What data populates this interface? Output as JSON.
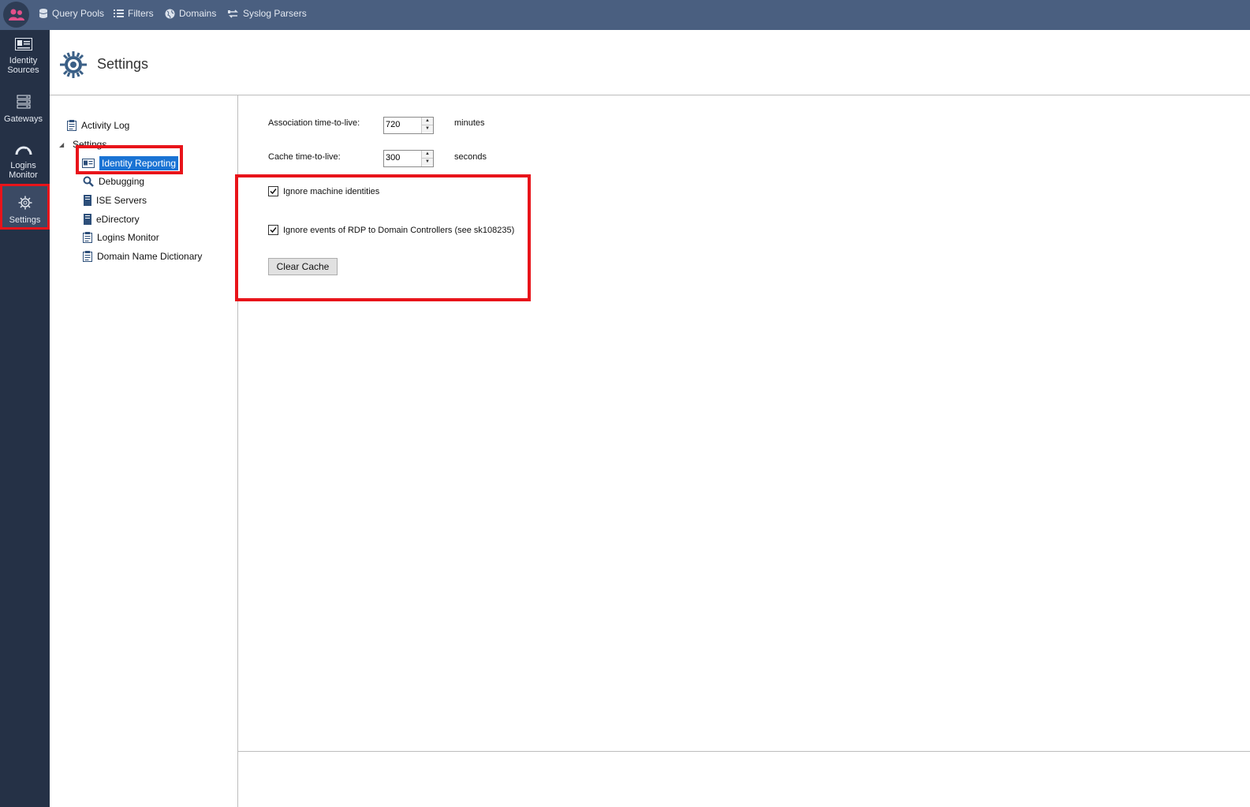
{
  "topbar": {
    "items": [
      {
        "label": "Query Pools",
        "icon": "database-icon"
      },
      {
        "label": "Filters",
        "icon": "list-icon"
      },
      {
        "label": "Domains",
        "icon": "globe-icon"
      },
      {
        "label": "Syslog Parsers",
        "icon": "parser-icon"
      }
    ]
  },
  "sidebar": {
    "items": [
      {
        "label": "Identity Sources",
        "icon": "id-card-icon"
      },
      {
        "label": "Gateways",
        "icon": "server-icon"
      },
      {
        "label": "Logins Monitor",
        "icon": "gauge-icon"
      },
      {
        "label": "Settings",
        "icon": "gear-icon",
        "active": true
      }
    ]
  },
  "header": {
    "title": "Settings"
  },
  "tree": {
    "activity_log": "Activity Log",
    "settings": "Settings",
    "children": [
      {
        "label": "Identity Reporting",
        "icon": "id-card-icon",
        "selected": true
      },
      {
        "label": "Debugging",
        "icon": "magnifier-icon"
      },
      {
        "label": "ISE Servers",
        "icon": "server-icon"
      },
      {
        "label": "eDirectory",
        "icon": "server-icon"
      },
      {
        "label": "Logins Monitor",
        "icon": "clipboard-icon"
      },
      {
        "label": "Domain Name Dictionary",
        "icon": "clipboard-icon"
      }
    ]
  },
  "form": {
    "association_label": "Association time-to-live:",
    "association_value": "720",
    "association_unit": "minutes",
    "cache_label": "Cache time-to-live:",
    "cache_value": "300",
    "cache_unit": "seconds",
    "ignore_machine_label": "Ignore machine identities",
    "ignore_machine_checked": true,
    "ignore_rdp_label": "Ignore events of RDP to Domain Controllers (see sk108235)",
    "ignore_rdp_checked": true,
    "clear_cache_label": "Clear Cache"
  },
  "colors": {
    "topbar": "#4a5f80",
    "sidebar": "#253146",
    "selection": "#1a73d4",
    "highlight": "#e8141a"
  }
}
